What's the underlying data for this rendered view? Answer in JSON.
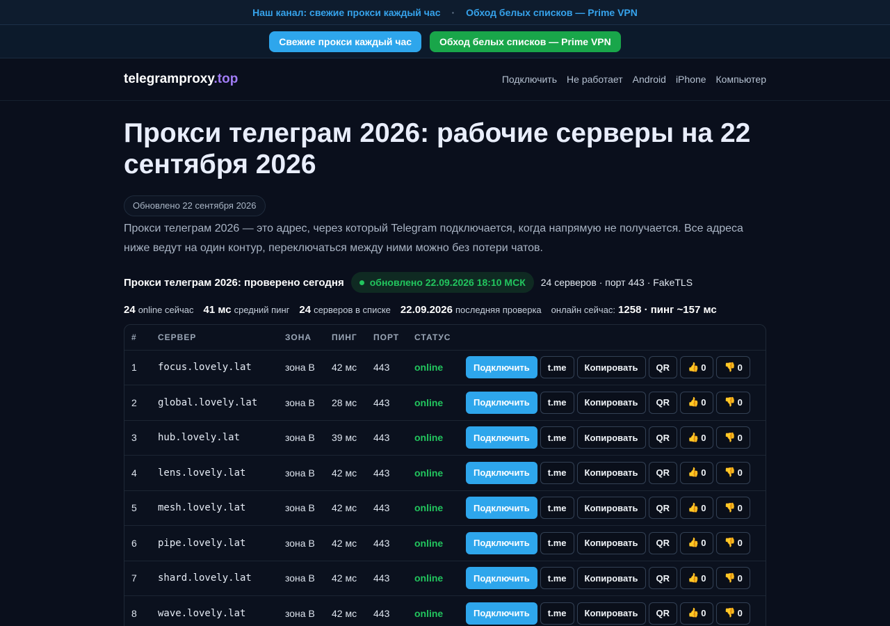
{
  "topbar": {
    "link1": "Наш канал: свежие прокси каждый час",
    "separator": "·",
    "link2": "Обход белых списков — Prime VPN"
  },
  "cta": {
    "blue": "Свежие прокси каждый час",
    "green": "Обход белых списков — Prime VPN",
    "blue_color": "#2ea6ec",
    "green_color": "#19a64a"
  },
  "header": {
    "logo_main": "telegramproxy",
    "logo_tld": ".top",
    "nav": [
      "Подключить",
      "Не работает",
      "Android",
      "iPhone",
      "Компьютер"
    ]
  },
  "main": {
    "title": "Прокси телеграм 2026: рабочие серверы на 22 сентября 2026",
    "updated": "Обновлено 22 сентября 2026",
    "lead": "Прокси телеграм 2026 — это адрес, через который Telegram подключается, когда напрямую не получается. Все адреса ниже ведут на один контур, переключаться между ними можно без потери чатов.",
    "status_title": "Прокси телеграм 2026: проверено сегодня",
    "status_pill": "обновлено 22.09.2026 18:10 МСК",
    "status_meta": "24 серверов · порт 443 · FakeTLS"
  },
  "stats": {
    "online_value": "24",
    "online_label": "online сейчас",
    "ping_value": "41 мс",
    "ping_label": "средний пинг",
    "servers_value": "24",
    "servers_label": "серверов в списке",
    "check_value": "22.09.2026",
    "check_label": "последняя проверка",
    "now_label": "онлайн сейчас:",
    "now_value": "1258 · пинг ~157 мс"
  },
  "table": {
    "headers": [
      "#",
      "СЕРВЕР",
      "ЗОНА",
      "ПИНГ",
      "ПОРТ",
      "СТАТУС",
      ""
    ],
    "rows": [
      {
        "n": "1",
        "host": "focus.lovely.lat",
        "zone": "зона B",
        "ping": "42 мс",
        "port": "443",
        "status": "online",
        "up": "0",
        "down": "0"
      },
      {
        "n": "2",
        "host": "global.lovely.lat",
        "zone": "зона B",
        "ping": "28 мс",
        "port": "443",
        "status": "online",
        "up": "0",
        "down": "0"
      },
      {
        "n": "3",
        "host": "hub.lovely.lat",
        "zone": "зона B",
        "ping": "39 мс",
        "port": "443",
        "status": "online",
        "up": "0",
        "down": "0"
      },
      {
        "n": "4",
        "host": "lens.lovely.lat",
        "zone": "зона B",
        "ping": "42 мс",
        "port": "443",
        "status": "online",
        "up": "0",
        "down": "0"
      },
      {
        "n": "5",
        "host": "mesh.lovely.lat",
        "zone": "зона B",
        "ping": "42 мс",
        "port": "443",
        "status": "online",
        "up": "0",
        "down": "0"
      },
      {
        "n": "6",
        "host": "pipe.lovely.lat",
        "zone": "зона B",
        "ping": "42 мс",
        "port": "443",
        "status": "online",
        "up": "0",
        "down": "0"
      },
      {
        "n": "7",
        "host": "shard.lovely.lat",
        "zone": "зона B",
        "ping": "42 мс",
        "port": "443",
        "status": "online",
        "up": "0",
        "down": "0"
      },
      {
        "n": "8",
        "host": "wave.lovely.lat",
        "zone": "зона B",
        "ping": "42 мс",
        "port": "443",
        "status": "online",
        "up": "0",
        "down": "0"
      }
    ],
    "actions": {
      "connect": "Подключить",
      "tme": "t.me",
      "copy": "Копировать",
      "qr": "QR",
      "like_icon": "👍",
      "dislike_icon": "👎"
    }
  }
}
